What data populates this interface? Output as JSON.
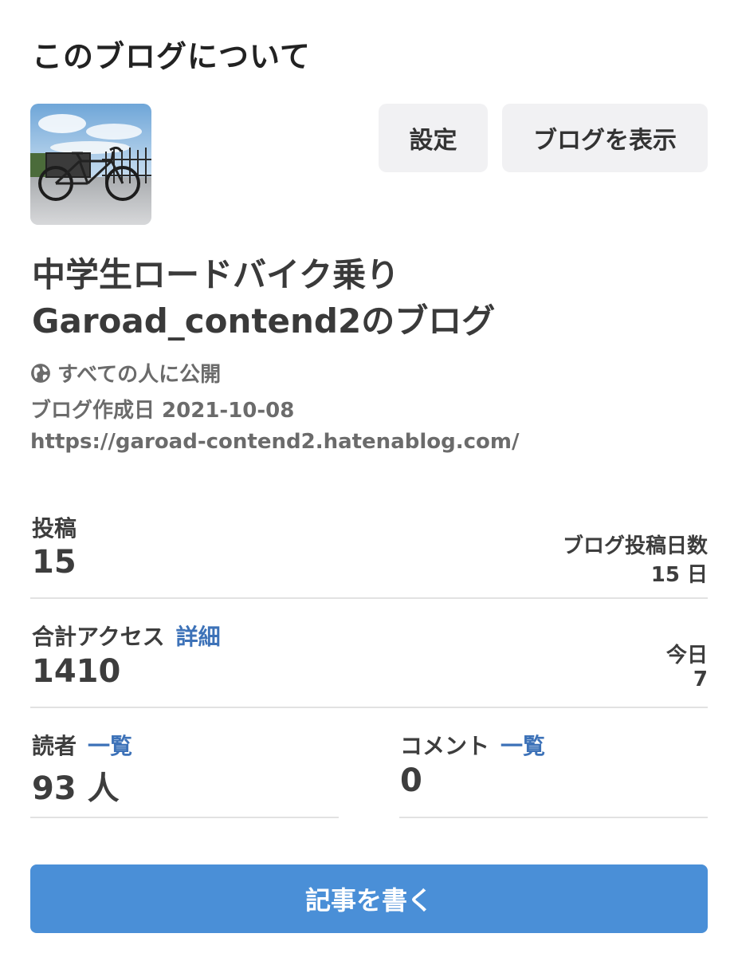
{
  "section_title": "このブログについて",
  "buttons": {
    "settings": "設定",
    "view_blog": "ブログを表示",
    "write_post": "記事を書く"
  },
  "blog": {
    "name_line1": "中学生ロードバイク乗り",
    "name_line2": "Garoad_contend2のブログ",
    "visibility": "すべての人に公開",
    "created": "ブログ作成日 2021-10-08",
    "url": "https://garoad-contend2.hatenablog.com/"
  },
  "stats": {
    "posts": {
      "label": "投稿",
      "value": "15",
      "side_label": "ブログ投稿日数",
      "side_value": "15 日"
    },
    "access": {
      "label": "合計アクセス",
      "link": "詳細",
      "value": "1410",
      "side_label": "今日",
      "side_value": "7"
    },
    "readers": {
      "label": "読者",
      "link": "一覧",
      "value": "93 人"
    },
    "comments": {
      "label": "コメント",
      "link": "一覧",
      "value": "0"
    }
  },
  "colors": {
    "accent_link": "#3d72b8",
    "primary_button": "#4a8fd7",
    "secondary_button_bg": "#f1f1f3"
  },
  "icons": {
    "visibility": "globe-icon",
    "avatar": "bicycle-photo"
  }
}
